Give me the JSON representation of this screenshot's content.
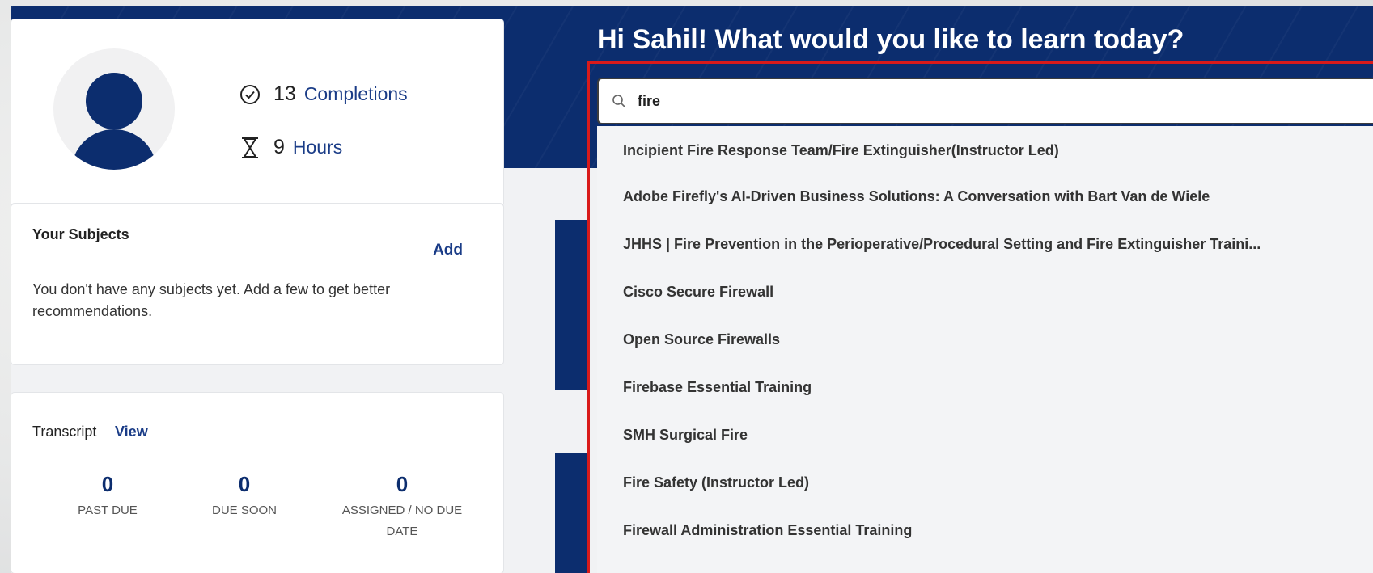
{
  "header": {
    "greeting": "Hi Sahil! What would you like to learn today?"
  },
  "profile": {
    "completions_count": "13",
    "completions_label": "Completions",
    "hours_count": "9",
    "hours_label": "Hours"
  },
  "subjects": {
    "title": "Your Subjects",
    "add_label": "Add",
    "empty_message": "You don't have any subjects yet. Add a few to get better recommendations."
  },
  "transcript": {
    "title": "Transcript",
    "view_label": "View",
    "stats": [
      {
        "value": "0",
        "label": "PAST DUE"
      },
      {
        "value": "0",
        "label": "DUE SOON"
      },
      {
        "value": "0",
        "label": "ASSIGNED / NO DUE DATE"
      }
    ]
  },
  "search": {
    "value": "fire",
    "suggestions": [
      "Incipient Fire Response Team/Fire Extinguisher(Instructor Led)",
      "Adobe Firefly's AI-Driven Business Solutions: A Conversation with Bart Van de Wiele",
      "JHHS | Fire Prevention in the Perioperative/Procedural Setting and Fire Extinguisher Traini...",
      "Cisco Secure Firewall",
      "Open Source Firewalls",
      "Firebase Essential Training",
      "SMH Surgical Fire",
      "Fire Safety (Instructor Led)",
      "Firewall Administration Essential Training"
    ]
  },
  "colors": {
    "brand_navy": "#0c2d6e",
    "link_blue": "#1a3c87",
    "highlight_red": "#d91a1a"
  }
}
